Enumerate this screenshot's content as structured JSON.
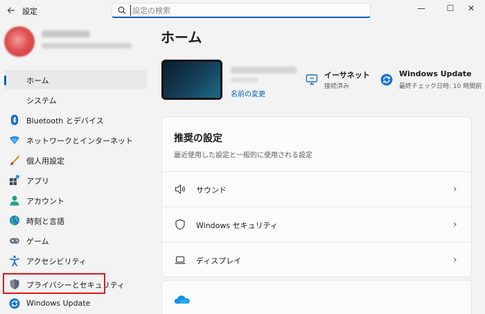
{
  "app": {
    "title": "設定"
  },
  "search": {
    "placeholder": "設定の検索"
  },
  "window_controls": {
    "minimize": "—",
    "maximize": "☐",
    "close": "✕"
  },
  "sidebar": {
    "items": [
      {
        "label": "ホーム",
        "icon": "home-icon",
        "active": true
      },
      {
        "label": "システム",
        "icon": "system-icon"
      },
      {
        "label": "Bluetooth とデバイス",
        "icon": "bluetooth-icon"
      },
      {
        "label": "ネットワークとインターネット",
        "icon": "network-icon"
      },
      {
        "label": "個人用設定",
        "icon": "personalization-icon"
      },
      {
        "label": "アプリ",
        "icon": "apps-icon"
      },
      {
        "label": "アカウント",
        "icon": "account-icon"
      },
      {
        "label": "時刻と言語",
        "icon": "time-language-icon"
      },
      {
        "label": "ゲーム",
        "icon": "gaming-icon"
      },
      {
        "label": "アクセシビリティ",
        "icon": "accessibility-icon"
      },
      {
        "label": "プライバシーとセキュリティ",
        "icon": "privacy-shield-icon",
        "highlighted": true
      },
      {
        "label": "Windows Update",
        "icon": "windows-update-icon"
      }
    ]
  },
  "main": {
    "title": "ホーム",
    "device": {
      "rename_label": "名前の変更"
    },
    "status": [
      {
        "title": "イーサネット",
        "subtitle": "接続済み",
        "icon": "ethernet-icon"
      },
      {
        "title": "Windows Update",
        "subtitle": "最終チェック日時: 10 時間前",
        "icon": "windows-update-icon"
      }
    ],
    "recommended": {
      "title": "推奨の設定",
      "subtitle": "最近使用した設定と一般的に使用される設定",
      "items": [
        {
          "label": "サウンド",
          "icon": "speaker-icon"
        },
        {
          "label": "Windows セキュリティ",
          "icon": "shield-icon"
        },
        {
          "label": "ディスプレイ",
          "icon": "laptop-icon"
        }
      ]
    }
  },
  "colors": {
    "accent": "#005fb8",
    "highlight": "#e3141a",
    "window_bg": "#f3f3f3",
    "card_bg": "#fbfbfb"
  }
}
